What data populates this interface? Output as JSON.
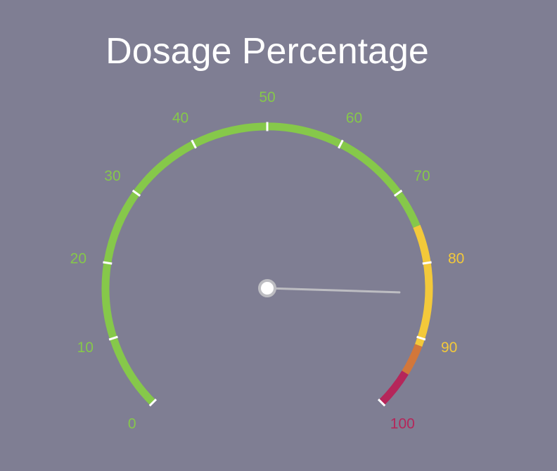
{
  "chart_data": {
    "type": "gauge",
    "title": "Dosage Percentage",
    "min": 0,
    "max": 100,
    "value": 84,
    "ticks": [
      {
        "value": 0,
        "label": "0"
      },
      {
        "value": 10,
        "label": "10"
      },
      {
        "value": 20,
        "label": "20"
      },
      {
        "value": 30,
        "label": "30"
      },
      {
        "value": 40,
        "label": "40"
      },
      {
        "value": 50,
        "label": "50"
      },
      {
        "value": 60,
        "label": "60"
      },
      {
        "value": 70,
        "label": "70"
      },
      {
        "value": 80,
        "label": "80"
      },
      {
        "value": 90,
        "label": "90"
      },
      {
        "value": 100,
        "label": "100"
      }
    ],
    "bands": [
      {
        "from": 0,
        "to": 75,
        "color": "#86c84a"
      },
      {
        "from": 75,
        "to": 91,
        "color": "#f3c93a"
      },
      {
        "from": 91,
        "to": 95,
        "color": "#d2773a"
      },
      {
        "from": 95,
        "to": 100,
        "color": "#b5265a"
      }
    ],
    "colors": {
      "background": "#7f7e93",
      "title": "#ffffff",
      "tick_mark": "#ffffff",
      "needle": "#bdbdc2",
      "pivot_fill": "#ffffff",
      "pivot_stroke": "#bdbdc2"
    }
  }
}
